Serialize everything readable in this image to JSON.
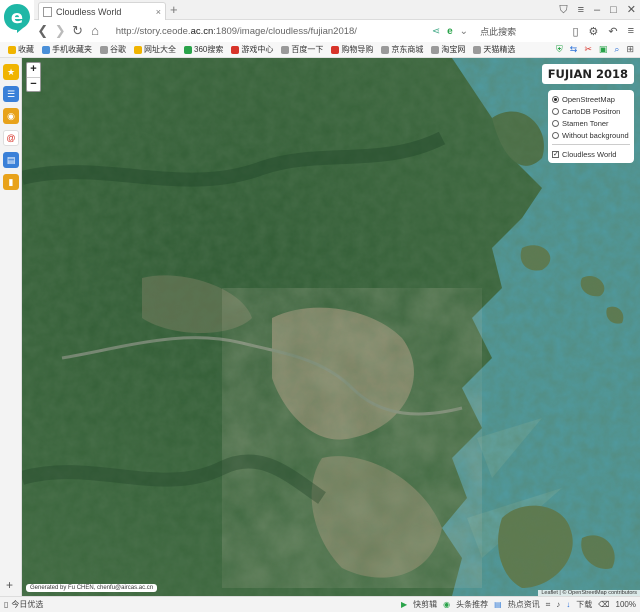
{
  "browser": {
    "tab_title": "Cloudless World",
    "url_prefix": "http://story.ceode.",
    "url_host": "ac.cn",
    "url_rest": ":1809/image/cloudless/fujian2018/",
    "search_placeholder": "点此搜索",
    "new_tab": "+",
    "logo_letter": "e"
  },
  "bookmarks": [
    {
      "label": "收藏",
      "color": "#f0b400"
    },
    {
      "label": "手机收藏夹",
      "color": "#4a8fd8"
    },
    {
      "label": "谷歌",
      "color": "#9a9a9a"
    },
    {
      "label": "网址大全",
      "color": "#f0b400"
    },
    {
      "label": "360搜索",
      "color": "#2aa34a"
    },
    {
      "label": "游戏中心",
      "color": "#d8342a"
    },
    {
      "label": "百度一下",
      "color": "#9a9a9a"
    },
    {
      "label": "购物导购",
      "color": "#d8342a"
    },
    {
      "label": "京东商城",
      "color": "#9a9a9a"
    },
    {
      "label": "淘宝网",
      "color": "#9a9a9a"
    },
    {
      "label": "天猫精选",
      "color": "#9a9a9a"
    }
  ],
  "map": {
    "title": "FUJIAN 2018",
    "zoom_in": "+",
    "zoom_out": "−",
    "base_layers": [
      {
        "label": "OpenStreetMap",
        "selected": true
      },
      {
        "label": "CartoDB Positron",
        "selected": false
      },
      {
        "label": "Stamen Toner",
        "selected": false
      },
      {
        "label": "Without background",
        "selected": false
      }
    ],
    "overlay": {
      "label": "Cloudless World",
      "checked": true
    },
    "credit": "Generated by Fu CHEN, chenfu@aircas.ac.cn",
    "attribution": "Leaflet | © OpenStreetMap contributors",
    "colors": {
      "sea": "#4f9aa0",
      "forest": "#35603a",
      "plain": "#8d8a6c"
    }
  },
  "status": {
    "left": "今日优选",
    "items": [
      "快剪辑",
      "头条推荐",
      "热点资讯",
      "下载"
    ],
    "zoom": "100%"
  }
}
